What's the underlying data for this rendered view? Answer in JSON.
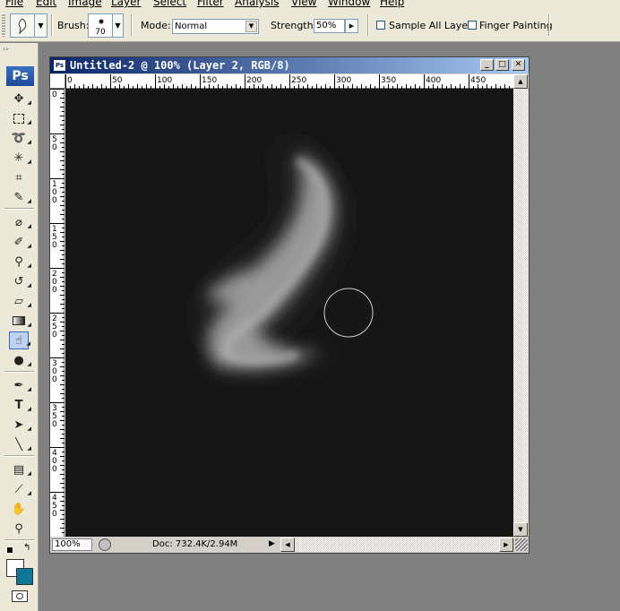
{
  "menu": [
    "File",
    "Edit",
    "Image",
    "Layer",
    "Select",
    "Filter",
    "Analysis",
    "View",
    "Window",
    "Help"
  ],
  "options": {
    "brush_label": "Brush:",
    "brush_size": "70",
    "mode_label": "Mode:",
    "mode_value": "Normal",
    "strength_label": "Strength:",
    "strength_value": "50%",
    "sample_all_layers": "Sample All Layers",
    "finger_painting": "Finger Painting"
  },
  "toolbox": {
    "logo": "Ps",
    "tools": [
      "move-icon",
      "marquee-icon",
      "lasso-icon",
      "magic-wand-icon",
      "crop-icon",
      "slice-icon",
      "healing-brush-icon",
      "brush-icon",
      "clone-stamp-icon",
      "history-brush-icon",
      "eraser-icon",
      "gradient-icon",
      "smudge-icon",
      "dodge-icon",
      "pen-icon",
      "type-icon",
      "path-selection-icon",
      "line-icon",
      "notes-icon",
      "eyedropper-icon",
      "hand-icon",
      "zoom-icon"
    ],
    "active_tool": "smudge-icon",
    "foreground_color": "#ffffff",
    "background_color": "#0e7597"
  },
  "document": {
    "title": "Untitled-2 @ 100% (Layer 2, RGB/8)",
    "ps_badge": "Ps",
    "zoom": "100%",
    "doc_info": "Doc: 732.4K/2.94M",
    "ruler_h": [
      "0",
      "50",
      "100",
      "150",
      "200",
      "250",
      "300",
      "350",
      "400",
      "450"
    ],
    "ruler_v": [
      "0",
      "5\n0",
      "1\n0\n0",
      "1\n5\n0",
      "2\n0\n0",
      "2\n5\n0",
      "3\n0\n0",
      "3\n5\n0",
      "4\n0\n0",
      "4\n5\n0"
    ],
    "canvas_color": "#161616",
    "stroke_color": "#a8a8a8"
  }
}
